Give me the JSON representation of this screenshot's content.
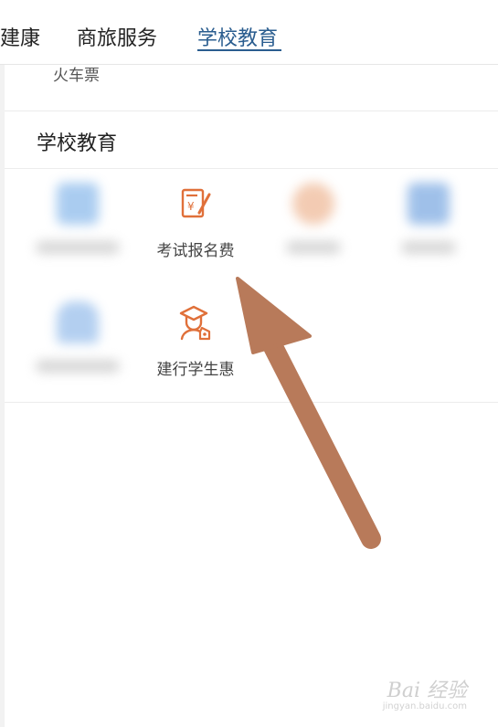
{
  "tabs": [
    {
      "label": "建康",
      "active": false
    },
    {
      "label": "商旅服务",
      "active": false
    },
    {
      "label": "学校教育",
      "active": true
    }
  ],
  "above_item": "火车票",
  "section": {
    "title": "学校教育",
    "items": [
      {
        "label": "考试报名费",
        "icon": "exam-fee-icon",
        "color": "#e0703a"
      },
      {
        "label": "建行学生惠",
        "icon": "graduate-coupon-icon",
        "color": "#e0703a"
      }
    ]
  },
  "colors": {
    "accent": "#2a5d8f",
    "icon_orange": "#e0703a",
    "arrow": "#b87a5a"
  },
  "watermark": {
    "brand": "Bai 经验",
    "url": "jingyan.baidu.com"
  }
}
